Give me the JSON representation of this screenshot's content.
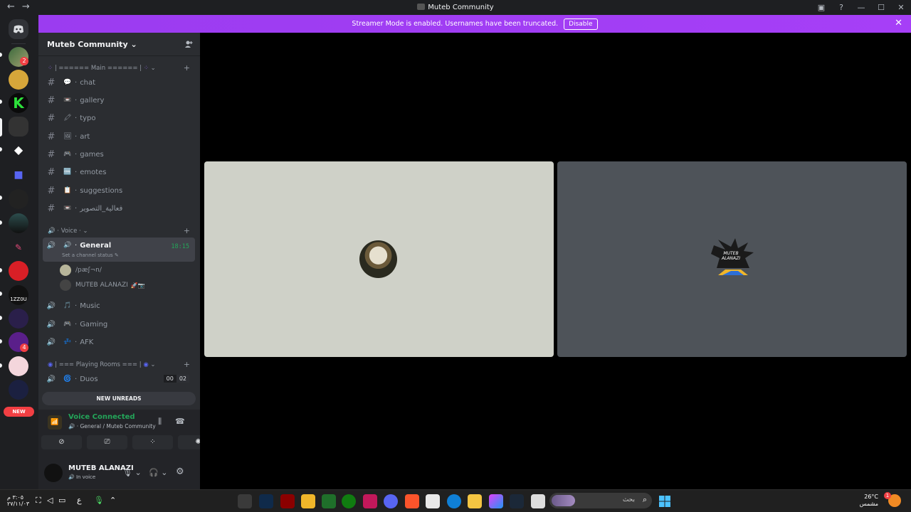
{
  "window": {
    "title": "Muteb Community",
    "back": "←",
    "forward": "→",
    "controls": [
      "▣",
      "?",
      "—",
      "☐",
      "✕"
    ]
  },
  "banner": {
    "text": "Streamer Mode is enabled. Usernames have been truncated.",
    "button": "Disable",
    "close": "✕"
  },
  "servers": {
    "badges": [
      "2",
      "4"
    ],
    "new_label": "NEW"
  },
  "guild": {
    "name": "Muteb Community ⌄"
  },
  "categories": {
    "main": "| ====== Main ====== |",
    "voice": "Voice",
    "playing": "| === Playing Rooms === |"
  },
  "text_channels": [
    {
      "emoji": "💬",
      "name": "chat"
    },
    {
      "emoji": "📼",
      "name": "gallery"
    },
    {
      "emoji": "🖍",
      "name": "typo"
    },
    {
      "emoji": "🖼",
      "name": "art"
    },
    {
      "emoji": "🎮",
      "name": "games"
    },
    {
      "emoji": "🆒",
      "name": "emotes"
    },
    {
      "emoji": "📋",
      "name": "suggestions"
    },
    {
      "emoji": "📼",
      "name": "فعالية_التصوير"
    }
  ],
  "voice_active": {
    "name": "General",
    "timer": "18:15",
    "status": "Set a channel status ✎"
  },
  "voice_users": [
    {
      "name": "/pæʃ¬n/"
    },
    {
      "name": "MUTEB ALANAZI"
    }
  ],
  "voice_channels": [
    {
      "emoji": "🎵",
      "name": "Music"
    },
    {
      "emoji": "🎮",
      "name": "Gaming"
    },
    {
      "emoji": "💤",
      "name": "AFK"
    }
  ],
  "playing_channels": [
    {
      "emoji": "🌀",
      "name": "Duos",
      "count_a": "00",
      "count_b": "02"
    }
  ],
  "new_unreads": "NEW UNREADS",
  "voice_panel": {
    "status": "Voice Connected",
    "sub": "General / Muteb Community"
  },
  "user": {
    "name": "MUTEB ALANAZI",
    "status": "In voice"
  },
  "stage": {
    "tile2_text": "MUTEB ALANAZI"
  },
  "taskbar": {
    "time": "٣:٠٥ م",
    "date": "٢٧/١١/٠٣",
    "lang": "ع",
    "search_text": "بحث",
    "temp": "26°C",
    "weather": "مشمس",
    "weather_badge": "1"
  },
  "colors": {
    "accent": "#a22bf5",
    "green": "#23a559",
    "sidebar": "#2b2d31",
    "rail": "#1e1f22",
    "tile1": "#cfd1c8",
    "tile2": "#4e5359"
  }
}
